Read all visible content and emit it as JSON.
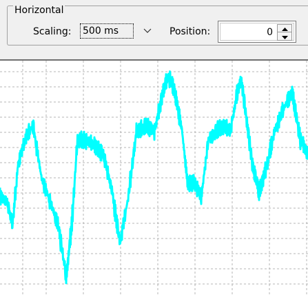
{
  "horizontal": {
    "title": "Horizontal",
    "scaling_label": "Scaling:",
    "scaling_value": "500 ms",
    "position_label": "Position:",
    "position_value": "0"
  },
  "icons": {
    "dropdown": "chevron-down-icon",
    "spin_up": "triangle-up-icon",
    "spin_down": "triangle-down-icon"
  },
  "colors": {
    "signal": "#00ffff",
    "grid": "#b4b4b4",
    "plot_background": "#ffffff",
    "panel_background": "#f0f0f0"
  },
  "waveform": {
    "stroke": "#00ffff",
    "keypoints": [
      [
        0,
        0.58
      ],
      [
        10,
        0.6
      ],
      [
        18,
        0.7
      ],
      [
        26,
        0.44
      ],
      [
        38,
        0.32
      ],
      [
        48,
        0.28
      ],
      [
        60,
        0.5
      ],
      [
        70,
        0.58
      ],
      [
        84,
        0.7
      ],
      [
        96,
        0.92
      ],
      [
        104,
        0.7
      ],
      [
        112,
        0.34
      ],
      [
        124,
        0.34
      ],
      [
        136,
        0.36
      ],
      [
        150,
        0.4
      ],
      [
        162,
        0.55
      ],
      [
        174,
        0.78
      ],
      [
        186,
        0.58
      ],
      [
        198,
        0.3
      ],
      [
        212,
        0.28
      ],
      [
        224,
        0.3
      ],
      [
        236,
        0.14
      ],
      [
        244,
        0.06
      ],
      [
        254,
        0.14
      ],
      [
        264,
        0.3
      ],
      [
        272,
        0.52
      ],
      [
        282,
        0.52
      ],
      [
        292,
        0.58
      ],
      [
        302,
        0.34
      ],
      [
        314,
        0.3
      ],
      [
        324,
        0.28
      ],
      [
        334,
        0.3
      ],
      [
        344,
        0.14
      ],
      [
        350,
        0.08
      ],
      [
        358,
        0.26
      ],
      [
        366,
        0.44
      ],
      [
        376,
        0.56
      ],
      [
        388,
        0.44
      ],
      [
        398,
        0.3
      ],
      [
        412,
        0.2
      ],
      [
        424,
        0.14
      ],
      [
        436,
        0.34
      ],
      [
        447,
        0.4
      ]
    ]
  }
}
